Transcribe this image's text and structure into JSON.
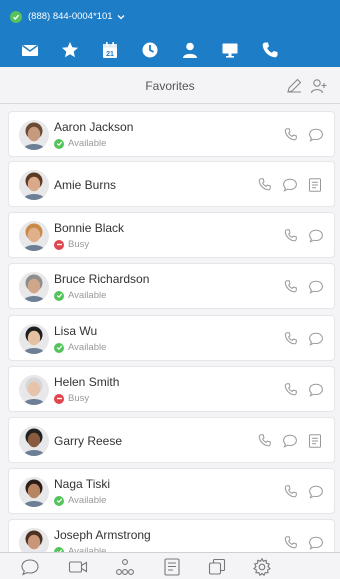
{
  "status": {
    "line_text": "(888) 844-0004*101",
    "color": "#1d7dc6",
    "available_color": "#55c35c"
  },
  "nav_icons": [
    "envelope-icon",
    "star-icon",
    "calendar-icon",
    "clock-icon",
    "person-icon",
    "monitor-icon",
    "phone-icon"
  ],
  "calendar_day": "21",
  "header": {
    "title": "Favorites"
  },
  "contacts": [
    {
      "name": "Aaron Jackson",
      "status": "Available",
      "status_color": "#55c35c",
      "avatar_color": "#c79a7e",
      "hair_color": "#6b4a33",
      "note_action": false
    },
    {
      "name": "Amie Burns",
      "status": "",
      "status_color": "",
      "avatar_color": "#d9a98a",
      "hair_color": "#5a3a22",
      "note_action": true
    },
    {
      "name": "Bonnie Black",
      "status": "Busy",
      "status_color": "#e0444c",
      "avatar_color": "#e0b08c",
      "hair_color": "#c98a48",
      "note_action": false
    },
    {
      "name": "Bruce Richardson",
      "status": "Available",
      "status_color": "#55c35c",
      "avatar_color": "#cfa68a",
      "hair_color": "#8e8e8e",
      "note_action": false
    },
    {
      "name": "Lisa Wu",
      "status": "Available",
      "status_color": "#55c35c",
      "avatar_color": "#e4c1a0",
      "hair_color": "#1e1e1e",
      "note_action": false
    },
    {
      "name": "Helen Smith",
      "status": "Busy",
      "status_color": "#e0444c",
      "avatar_color": "#e6c3ab",
      "hair_color": "#d6d6d6",
      "note_action": false
    },
    {
      "name": "Garry Reese",
      "status": "",
      "status_color": "",
      "avatar_color": "#8a5a3e",
      "hair_color": "#222222",
      "note_action": true
    },
    {
      "name": "Naga Tiski",
      "status": "Available",
      "status_color": "#55c35c",
      "avatar_color": "#b98462",
      "hair_color": "#2a1e18",
      "note_action": false
    },
    {
      "name": "Joseph Armstrong",
      "status": "Available",
      "status_color": "#55c35c",
      "avatar_color": "#c99677",
      "hair_color": "#4a3222",
      "note_action": false
    }
  ],
  "bottom_tabs": [
    "chat-bubble-icon",
    "video-camera-icon",
    "people-dots-icon",
    "notes-icon",
    "copy-window-icon",
    "settings-gear-icon"
  ]
}
